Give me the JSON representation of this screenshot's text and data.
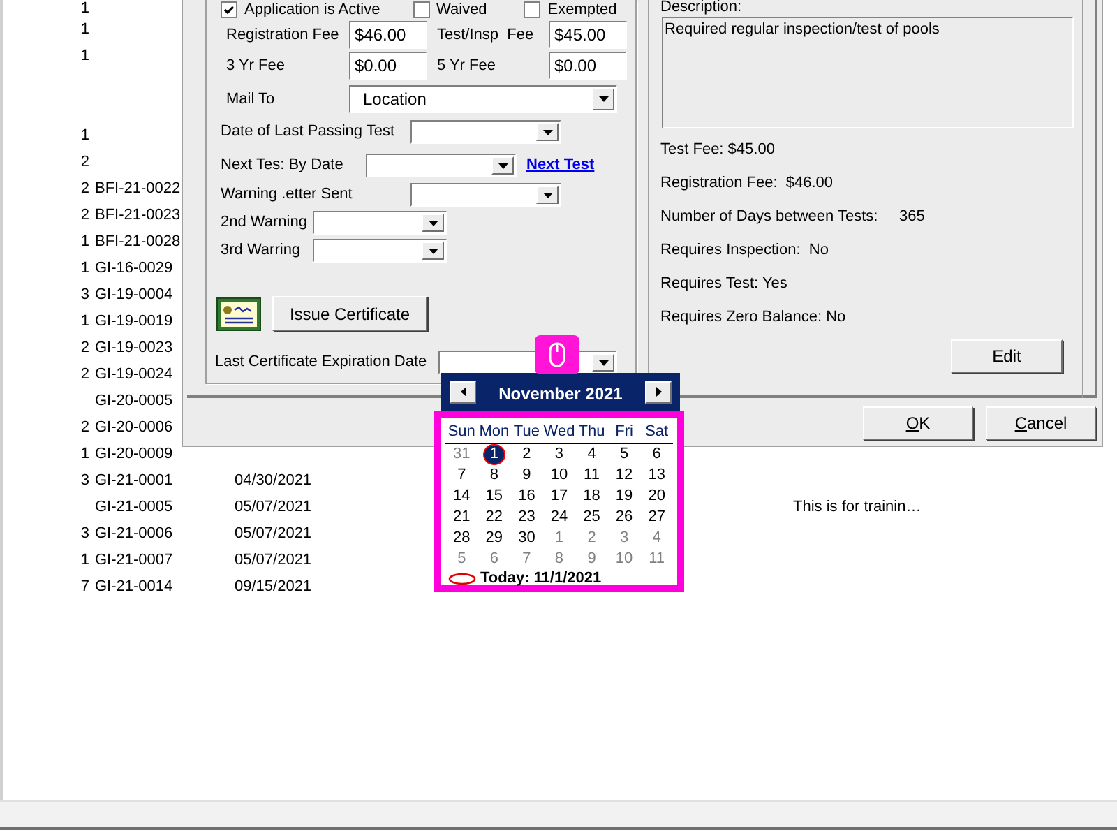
{
  "list": {
    "rows": [
      {
        "count": "1"
      },
      {
        "count": "1"
      },
      {
        "count": "1"
      },
      {},
      {},
      {
        "count": "1"
      },
      {
        "count": "2"
      },
      {
        "count": "2",
        "id": "BFI-21-0022"
      },
      {
        "count": "2",
        "id": "BFI-21-0023"
      },
      {
        "count": "1",
        "id": "BFI-21-0028"
      },
      {
        "count": "1",
        "id": "GI-16-0029"
      },
      {
        "count": "3",
        "id": "GI-19-0004"
      },
      {
        "count": "1",
        "id": "GI-19-0019"
      },
      {
        "count": "2",
        "id": "GI-19-0023"
      },
      {
        "count": "2",
        "id": "GI-19-0024"
      },
      {
        "id": "GI-20-0005"
      },
      {
        "count": "2",
        "id": "GI-20-0006"
      },
      {
        "count": "1",
        "id": "GI-20-0009"
      },
      {
        "count": "3",
        "id": "GI-21-0001",
        "date": "04/30/2021"
      },
      {
        "id": "GI-21-0005",
        "date": "05/07/2021",
        "note": "This is for trainin…"
      },
      {
        "count": "3",
        "id": "GI-21-0006",
        "date": "05/07/2021"
      },
      {
        "count": "1",
        "id": "GI-21-0007",
        "date": "05/07/2021"
      },
      {
        "count": "7",
        "id": "GI-21-0014",
        "date": "09/15/2021"
      }
    ]
  },
  "dialog": {
    "flags": [
      {
        "label": "Application is Active",
        "checked": true
      },
      {
        "label": "Waived",
        "checked": false
      },
      {
        "label": "Exempted",
        "checked": false
      }
    ],
    "fees": [
      {
        "label": "Registration Fee",
        "value": "$46.00"
      },
      {
        "label": "Test/Insp  Fee",
        "value": "$45.00"
      },
      {
        "label": "3 Yr Fee",
        "value": "$0.00"
      },
      {
        "label": "5 Yr Fee",
        "value": "$0.00"
      }
    ],
    "mail_to": {
      "label": "Mail To",
      "value": "Location"
    },
    "last_passing_test": {
      "label": "Date of Last Passing Test"
    },
    "next_test_by_date": {
      "label": "Next Tes: By Date",
      "link": "Next Test"
    },
    "warning_letter_sent": {
      "label": "Warning .etter Sent"
    },
    "second_warning": {
      "label": "2nd Warning"
    },
    "third_warning": {
      "label": "3rd Warring"
    },
    "issue_certificate_button": "Issue Certificate",
    "last_certificate_expiration": {
      "label": "Last Certificate Expiration Date"
    },
    "description": {
      "label": "Description:",
      "text": "Required regular inspection/test of pools"
    },
    "info": [
      "Test Fee: $45.00",
      "Registration Fee:  $46.00",
      "Number of Days between Tests:     365",
      "Requires Inspection:  No",
      "Requires Test: Yes",
      "Requires Zero Balance: No"
    ],
    "edit_button": "Edit",
    "ok_button": "OK",
    "cancel_button": "Cancel"
  },
  "calendar": {
    "title": "November 2021",
    "weekdays": [
      "Sun",
      "Mon",
      "Tue",
      "Wed",
      "Thu",
      "Fri",
      "Sat"
    ],
    "weeks": [
      [
        {
          "day": "31",
          "other_month": true,
          "selected": false
        },
        {
          "day": "1",
          "other_month": false,
          "selected": true
        },
        {
          "day": "2",
          "other_month": false,
          "selected": false
        },
        {
          "day": "3",
          "other_month": false,
          "selected": false
        },
        {
          "day": "4",
          "other_month": false,
          "selected": false
        },
        {
          "day": "5",
          "other_month": false,
          "selected": false
        },
        {
          "day": "6",
          "other_month": false,
          "selected": false
        }
      ],
      [
        {
          "day": "7",
          "other_month": false,
          "selected": false
        },
        {
          "day": "8",
          "other_month": false,
          "selected": false
        },
        {
          "day": "9",
          "other_month": false,
          "selected": false
        },
        {
          "day": "10",
          "other_month": false,
          "selected": false
        },
        {
          "day": "11",
          "other_month": false,
          "selected": false
        },
        {
          "day": "12",
          "other_month": false,
          "selected": false
        },
        {
          "day": "13",
          "other_month": false,
          "selected": false
        }
      ],
      [
        {
          "day": "14",
          "other_month": false,
          "selected": false
        },
        {
          "day": "15",
          "other_month": false,
          "selected": false
        },
        {
          "day": "16",
          "other_month": false,
          "selected": false
        },
        {
          "day": "17",
          "other_month": false,
          "selected": false
        },
        {
          "day": "18",
          "other_month": false,
          "selected": false
        },
        {
          "day": "19",
          "other_month": false,
          "selected": false
        },
        {
          "day": "20",
          "other_month": false,
          "selected": false
        }
      ],
      [
        {
          "day": "21",
          "other_month": false,
          "selected": false
        },
        {
          "day": "22",
          "other_month": false,
          "selected": false
        },
        {
          "day": "23",
          "other_month": false,
          "selected": false
        },
        {
          "day": "24",
          "other_month": false,
          "selected": false
        },
        {
          "day": "25",
          "other_month": false,
          "selected": false
        },
        {
          "day": "26",
          "other_month": false,
          "selected": false
        },
        {
          "day": "27",
          "other_month": false,
          "selected": false
        }
      ],
      [
        {
          "day": "28",
          "other_month": false,
          "selected": false
        },
        {
          "day": "29",
          "other_month": false,
          "selected": false
        },
        {
          "day": "30",
          "other_month": false,
          "selected": false
        },
        {
          "day": "1",
          "other_month": true,
          "selected": false
        },
        {
          "day": "2",
          "other_month": true,
          "selected": false
        },
        {
          "day": "3",
          "other_month": true,
          "selected": false
        },
        {
          "day": "4",
          "other_month": true,
          "selected": false
        }
      ],
      [
        {
          "day": "5",
          "other_month": true,
          "selected": false
        },
        {
          "day": "6",
          "other_month": true,
          "selected": false
        },
        {
          "day": "7",
          "other_month": true,
          "selected": false
        },
        {
          "day": "8",
          "other_month": true,
          "selected": false
        },
        {
          "day": "9",
          "other_month": true,
          "selected": false
        },
        {
          "day": "10",
          "other_month": true,
          "selected": false
        },
        {
          "day": "11",
          "other_month": true,
          "selected": false
        }
      ]
    ],
    "today": "Today: 11/1/2021"
  }
}
